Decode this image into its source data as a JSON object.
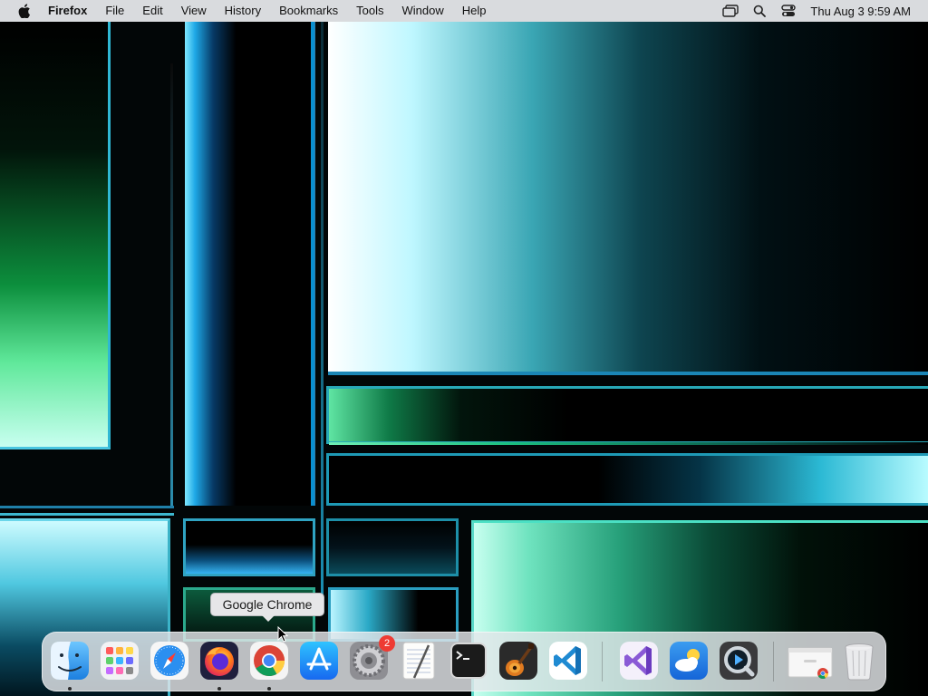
{
  "menubar": {
    "app_name": "Firefox",
    "menus": [
      "File",
      "Edit",
      "View",
      "History",
      "Bookmarks",
      "Tools",
      "Window",
      "Help"
    ],
    "status_icons": [
      "screen-mirroring-icon",
      "spotlight-search-icon",
      "control-center-icon"
    ],
    "clock": "Thu Aug 3  9:59 AM"
  },
  "tooltip": {
    "text": "Google Chrome"
  },
  "dock": {
    "items": [
      {
        "name": "finder",
        "running": true
      },
      {
        "name": "launchpad",
        "running": false
      },
      {
        "name": "safari",
        "running": false
      },
      {
        "name": "firefox",
        "running": true
      },
      {
        "name": "google-chrome",
        "running": true
      },
      {
        "name": "app-store",
        "running": false
      },
      {
        "name": "system-settings",
        "running": false,
        "badge": "2"
      },
      {
        "name": "textedit",
        "running": false
      },
      {
        "name": "terminal",
        "running": false
      },
      {
        "name": "garageband",
        "running": false
      },
      {
        "name": "visual-studio-code",
        "running": false
      },
      {
        "name": "visual-studio",
        "running": false
      },
      {
        "name": "weather",
        "running": false
      },
      {
        "name": "quicktime-player",
        "running": false
      },
      {
        "name": "chrome-window-preview",
        "running": false
      },
      {
        "name": "trash",
        "running": false
      }
    ]
  }
}
